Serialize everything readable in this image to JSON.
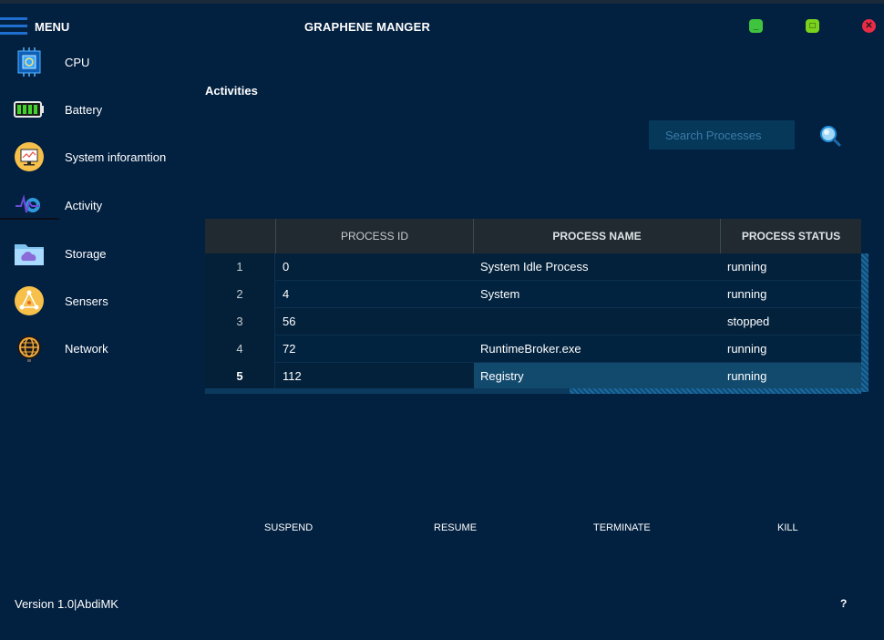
{
  "app": {
    "menu_label": "MENU",
    "title": "GRAPHENE  MANGER",
    "window_controls": {
      "minimize": "_",
      "maximize": "□",
      "close": "✕"
    },
    "colors": {
      "background": "#022040",
      "minimize": "#3ec43e",
      "maximize": "#79d21b",
      "close": "#ea2b45",
      "selection": "#124a6e"
    }
  },
  "sidebar": {
    "items": [
      {
        "label": "CPU",
        "icon": "cpu-icon"
      },
      {
        "label": "Battery",
        "icon": "battery-icon"
      },
      {
        "label": "System inforamtion",
        "icon": "monitor-icon"
      },
      {
        "label": "Activity",
        "icon": "activity-icon"
      },
      {
        "label": "Storage",
        "icon": "folder-icon"
      },
      {
        "label": "Sensers",
        "icon": "sensor-icon"
      },
      {
        "label": "Network",
        "icon": "globe-icon"
      }
    ],
    "active": "Activity"
  },
  "main": {
    "section_title": "Activities",
    "search": {
      "placeholder": "Search Processes",
      "value": "",
      "icon": "search-icon"
    },
    "table": {
      "columns": [
        "",
        "PROCESS ID",
        "PROCESS NAME",
        "PROCESS STATUS"
      ],
      "rows": [
        {
          "index": "1",
          "pid": "0",
          "name": "System Idle Process",
          "status": "running"
        },
        {
          "index": "2",
          "pid": "4",
          "name": "System",
          "status": "running"
        },
        {
          "index": "3",
          "pid": "56",
          "name": "",
          "status": "stopped"
        },
        {
          "index": "4",
          "pid": "72",
          "name": "RuntimeBroker.exe",
          "status": "running"
        },
        {
          "index": "5",
          "pid": "112",
          "name": "Registry",
          "status": "running"
        }
      ],
      "selected_row_index": "5"
    },
    "actions": {
      "suspend": "SUSPEND",
      "resume": "RESUME",
      "terminate": "TERMINATE",
      "kill": "KILL"
    }
  },
  "footer": {
    "version": "Version 1.0|AbdiMK",
    "help": "?"
  }
}
